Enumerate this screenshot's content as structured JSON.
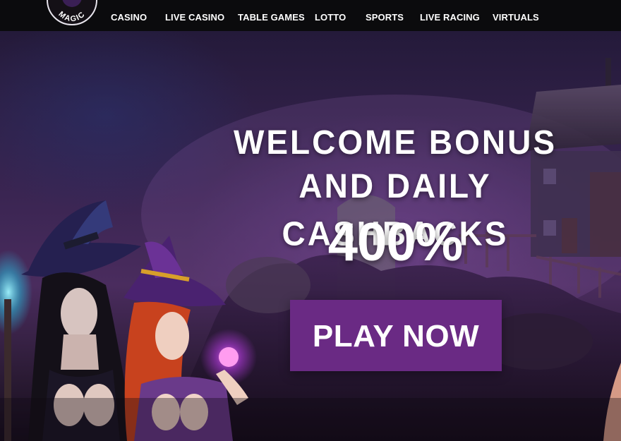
{
  "logo": {
    "text": "MAGIC"
  },
  "nav": {
    "items": [
      {
        "label": "CASINO"
      },
      {
        "label": "LIVE CASINO"
      },
      {
        "label": "TABLE GAMES"
      },
      {
        "label": "LOTTO"
      },
      {
        "label": "SPORTS"
      },
      {
        "label": "LIVE RACING"
      },
      {
        "label": "VIRTUALS"
      }
    ]
  },
  "hero": {
    "headline_line1": "WELCOME BONUS",
    "headline_line2": "AND DAILY CASHBACKS",
    "bonus_percent": "400%",
    "cta_label": "PLAY NOW"
  },
  "colors": {
    "nav_background": "#0b0b0d",
    "cta_background": "#6a2a84",
    "text": "#ffffff"
  }
}
